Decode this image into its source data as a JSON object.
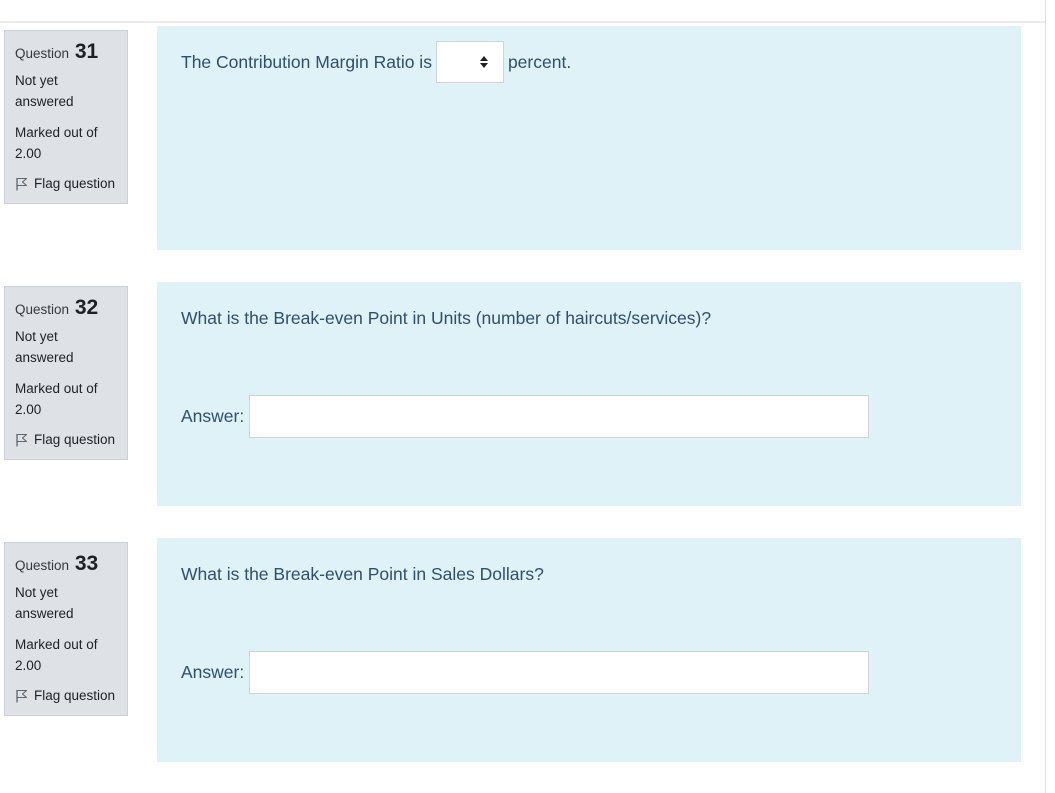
{
  "questions": [
    {
      "label": "Question",
      "number": "31",
      "state": "Not yet answered",
      "grade": "Marked out of 2.00",
      "flag_label": "Flag question",
      "text_before": "The Contribution Margin Ratio is",
      "text_after": "percent.",
      "select_value": ""
    },
    {
      "label": "Question",
      "number": "32",
      "state": "Not yet answered",
      "grade": "Marked out of 2.00",
      "flag_label": "Flag question",
      "text": "What is the Break-even Point in Units (number of haircuts/services)?",
      "answer_label": "Answer:",
      "answer_value": ""
    },
    {
      "label": "Question",
      "number": "33",
      "state": "Not yet answered",
      "grade": "Marked out of 2.00",
      "flag_label": "Flag question",
      "text": "What is the Break-even Point in Sales Dollars?",
      "answer_label": "Answer:",
      "answer_value": ""
    }
  ],
  "icons": {
    "flag": "flag-outline-icon",
    "select_arrows": "up-down-caret-icon"
  },
  "colors": {
    "info_bg": "#dee2e6",
    "content_bg": "#def2f8",
    "question_text": "#2f4f6b"
  }
}
